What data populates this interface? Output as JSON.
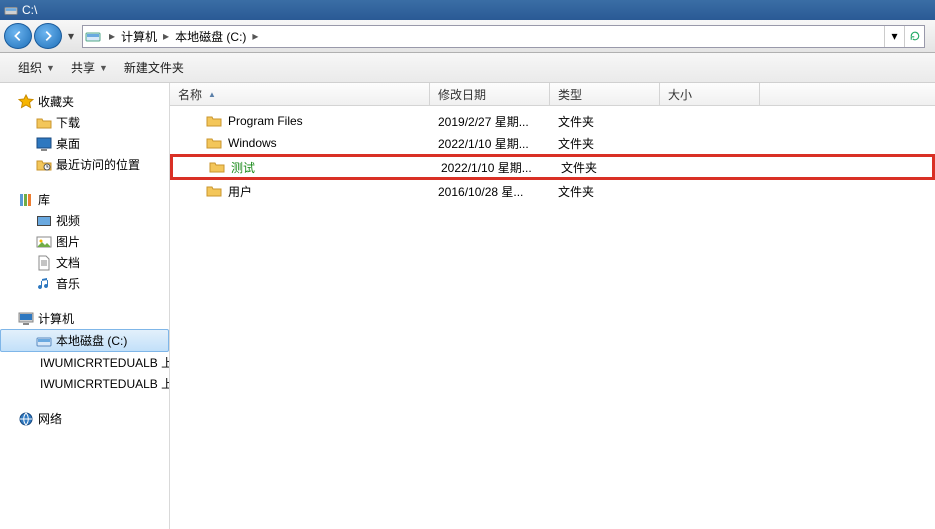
{
  "title": "C:\\",
  "breadcrumb": {
    "computer": "计算机",
    "drive": "本地磁盘 (C:)"
  },
  "toolbar": {
    "organize": "组织",
    "share": "共享",
    "newfolder": "新建文件夹"
  },
  "sidebar": {
    "favorites": {
      "label": "收藏夹",
      "items": [
        "下载",
        "桌面",
        "最近访问的位置"
      ]
    },
    "libraries": {
      "label": "库",
      "items": [
        "视频",
        "图片",
        "文档",
        "音乐"
      ]
    },
    "computer": {
      "label": "计算机",
      "items": [
        "本地磁盘 (C:)",
        "IWUMICRRTEDUALB 上",
        "IWUMICRRTEDUALB 上"
      ]
    },
    "network": {
      "label": "网络"
    }
  },
  "columns": {
    "name": "名称",
    "date": "修改日期",
    "type": "类型",
    "size": "大小"
  },
  "rows": [
    {
      "name": "Program Files",
      "date": "2019/2/27 星期...",
      "type": "文件夹",
      "hl": false
    },
    {
      "name": "Windows",
      "date": "2022/1/10 星期...",
      "type": "文件夹",
      "hl": false
    },
    {
      "name": "测试",
      "date": "2022/1/10 星期...",
      "type": "文件夹",
      "hl": true
    },
    {
      "name": "用户",
      "date": "2016/10/28 星...",
      "type": "文件夹",
      "hl": false
    }
  ]
}
